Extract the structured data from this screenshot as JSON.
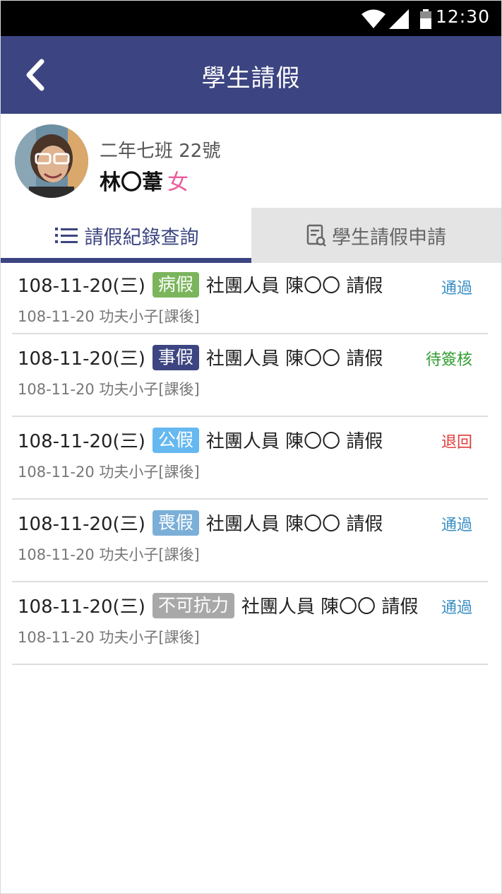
{
  "status_bar": {
    "time": "12:30"
  },
  "app_bar": {
    "title": "學生請假"
  },
  "student": {
    "class_info": "二年七班 22號",
    "name": "林〇葦",
    "gender": "女"
  },
  "tabs": [
    {
      "label": "請假紀錄查詢",
      "icon": "list-icon"
    },
    {
      "label": "學生請假申請",
      "icon": "form-icon"
    }
  ],
  "colors": {
    "primary": "#3c4581",
    "sick": "#7ab55c",
    "personal": "#3c4581",
    "official": "#66b8f0",
    "funeral": "#7bafd8",
    "force_majeure": "#a8a8a8",
    "approved": "#3a8fc4",
    "pending": "#2f9e2f",
    "rejected": "#e33a3a"
  },
  "records": [
    {
      "date": "108-11-20(三)",
      "type": "病假",
      "desc": "社團人員 陳〇〇 請假",
      "sub": "108-11-20 功夫小子[課後]",
      "status": "通過"
    },
    {
      "date": "108-11-20(三)",
      "type": "事假",
      "desc": "社團人員 陳〇〇 請假",
      "sub": "108-11-20 功夫小子[課後]",
      "status": "待簽核"
    },
    {
      "date": "108-11-20(三)",
      "type": "公假",
      "desc": "社團人員 陳〇〇 請假",
      "sub": "108-11-20 功夫小子[課後]",
      "status": "退回"
    },
    {
      "date": "108-11-20(三)",
      "type": "喪假",
      "desc": "社團人員 陳〇〇 請假",
      "sub": "108-11-20 功夫小子[課後]",
      "status": "通過"
    },
    {
      "date": "108-11-20(三)",
      "type": "不可抗力",
      "desc": "社團人員 陳〇〇 請假",
      "sub": "108-11-20 功夫小子[課後]",
      "status": "通過"
    }
  ]
}
